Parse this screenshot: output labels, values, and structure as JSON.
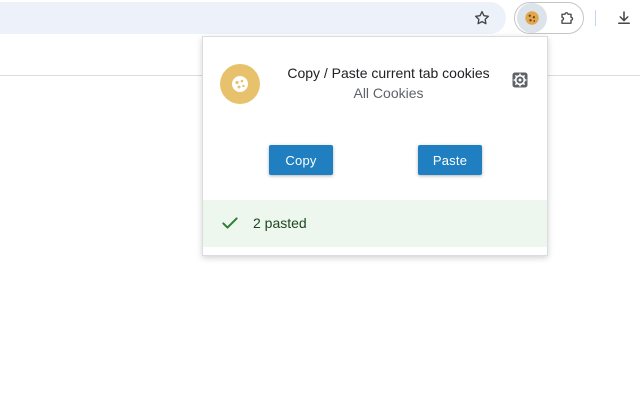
{
  "browser": {
    "icons": {
      "bookmark": "star-icon",
      "extension": "cookie-icon",
      "extensions_menu": "puzzle-icon",
      "downloads": "download-icon"
    }
  },
  "popup": {
    "title": "Copy / Paste current tab cookies",
    "subtitle": "All Cookies",
    "copy_label": "Copy",
    "paste_label": "Paste",
    "status_message": "2 pasted",
    "colors": {
      "logo_bg": "#e7c16c",
      "button": "#1f7fc0",
      "status_bg": "#edf7ed",
      "status_check": "#2e7d32"
    }
  }
}
